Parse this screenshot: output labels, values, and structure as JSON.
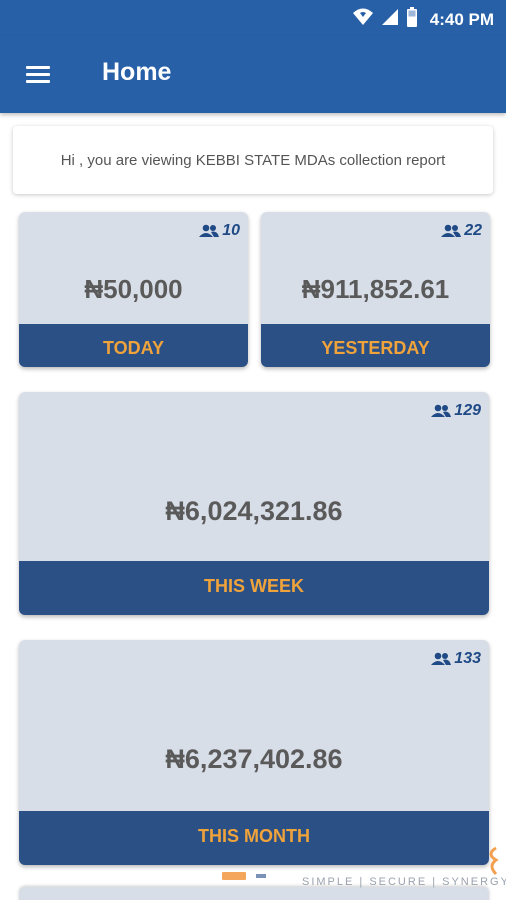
{
  "status_bar": {
    "time": "4:40 PM",
    "icons": [
      "wifi-icon",
      "signal-icon",
      "battery-icon"
    ]
  },
  "app_bar": {
    "title": "Home",
    "menu_icon": "hamburger-menu-icon"
  },
  "banner": {
    "text": "Hi , you are viewing KEBBI STATE MDAs collection report"
  },
  "cards": {
    "today": {
      "count": "10",
      "amount": "₦50,000",
      "label": "TODAY"
    },
    "yesterday": {
      "count": "22",
      "amount": "₦911,852.61",
      "label": "YESTERDAY"
    },
    "this_week": {
      "count": "129",
      "amount": "₦6,024,321.86",
      "label": "THIS WEEK"
    },
    "this_month": {
      "count": "133",
      "amount": "₦6,237,402.86",
      "label": "THIS MONTH"
    }
  },
  "watermark": {
    "text": "SIMPLE | SECURE | SYNERGY"
  },
  "colors": {
    "primary": "#2860a8",
    "card_background": "#d8dee8",
    "card_label_background": "#2b5086",
    "card_label_text": "#f0a33a",
    "count_text": "#1f4a86",
    "amount_text": "#5a5a5a"
  }
}
